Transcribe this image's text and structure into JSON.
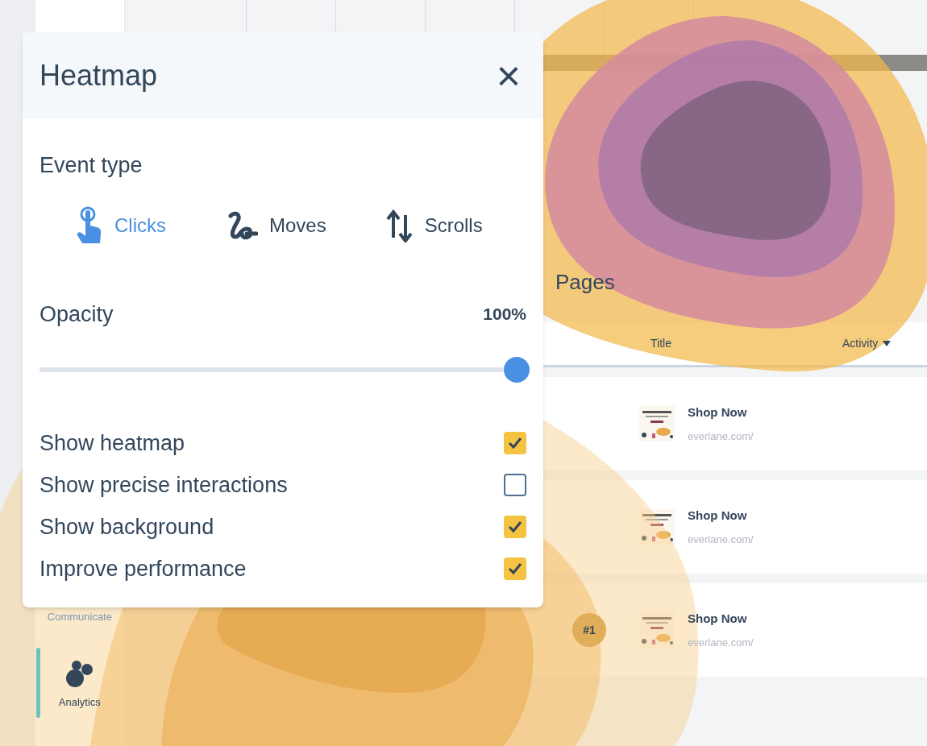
{
  "sidebar": {
    "items": [
      {
        "kind": "communicate",
        "label": "Communicate",
        "selected": false
      },
      {
        "kind": "analytics",
        "label": "Analytics",
        "selected": true
      }
    ]
  },
  "page_title": "Pages",
  "table": {
    "columns": [
      {
        "label": "Title",
        "sorted": false
      },
      {
        "label": "Activity",
        "sorted": true
      }
    ],
    "rows": [
      {
        "title": "Shop Now",
        "url": "everlane.com/"
      },
      {
        "title": "Shop Now",
        "url": "everlane.com/"
      },
      {
        "rank": "#1",
        "title": "Shop Now",
        "url": "everlane.com/"
      }
    ]
  },
  "panel": {
    "title": "Heatmap",
    "close": "×",
    "event_type_label": "Event type",
    "event_types": [
      {
        "kind": "clicks",
        "label": "Clicks",
        "selected": true
      },
      {
        "kind": "moves",
        "label": "Moves",
        "selected": false
      },
      {
        "kind": "scrolls",
        "label": "Scrolls",
        "selected": false
      }
    ],
    "opacity": {
      "label": "Opacity",
      "reading": "100%",
      "level": 1
    },
    "options": [
      {
        "label": "Show heatmap",
        "checked": true
      },
      {
        "label": "Show precise interactions",
        "checked": false
      },
      {
        "label": "Show background",
        "checked": true
      },
      {
        "label": "Improve performance",
        "checked": true
      }
    ]
  }
}
